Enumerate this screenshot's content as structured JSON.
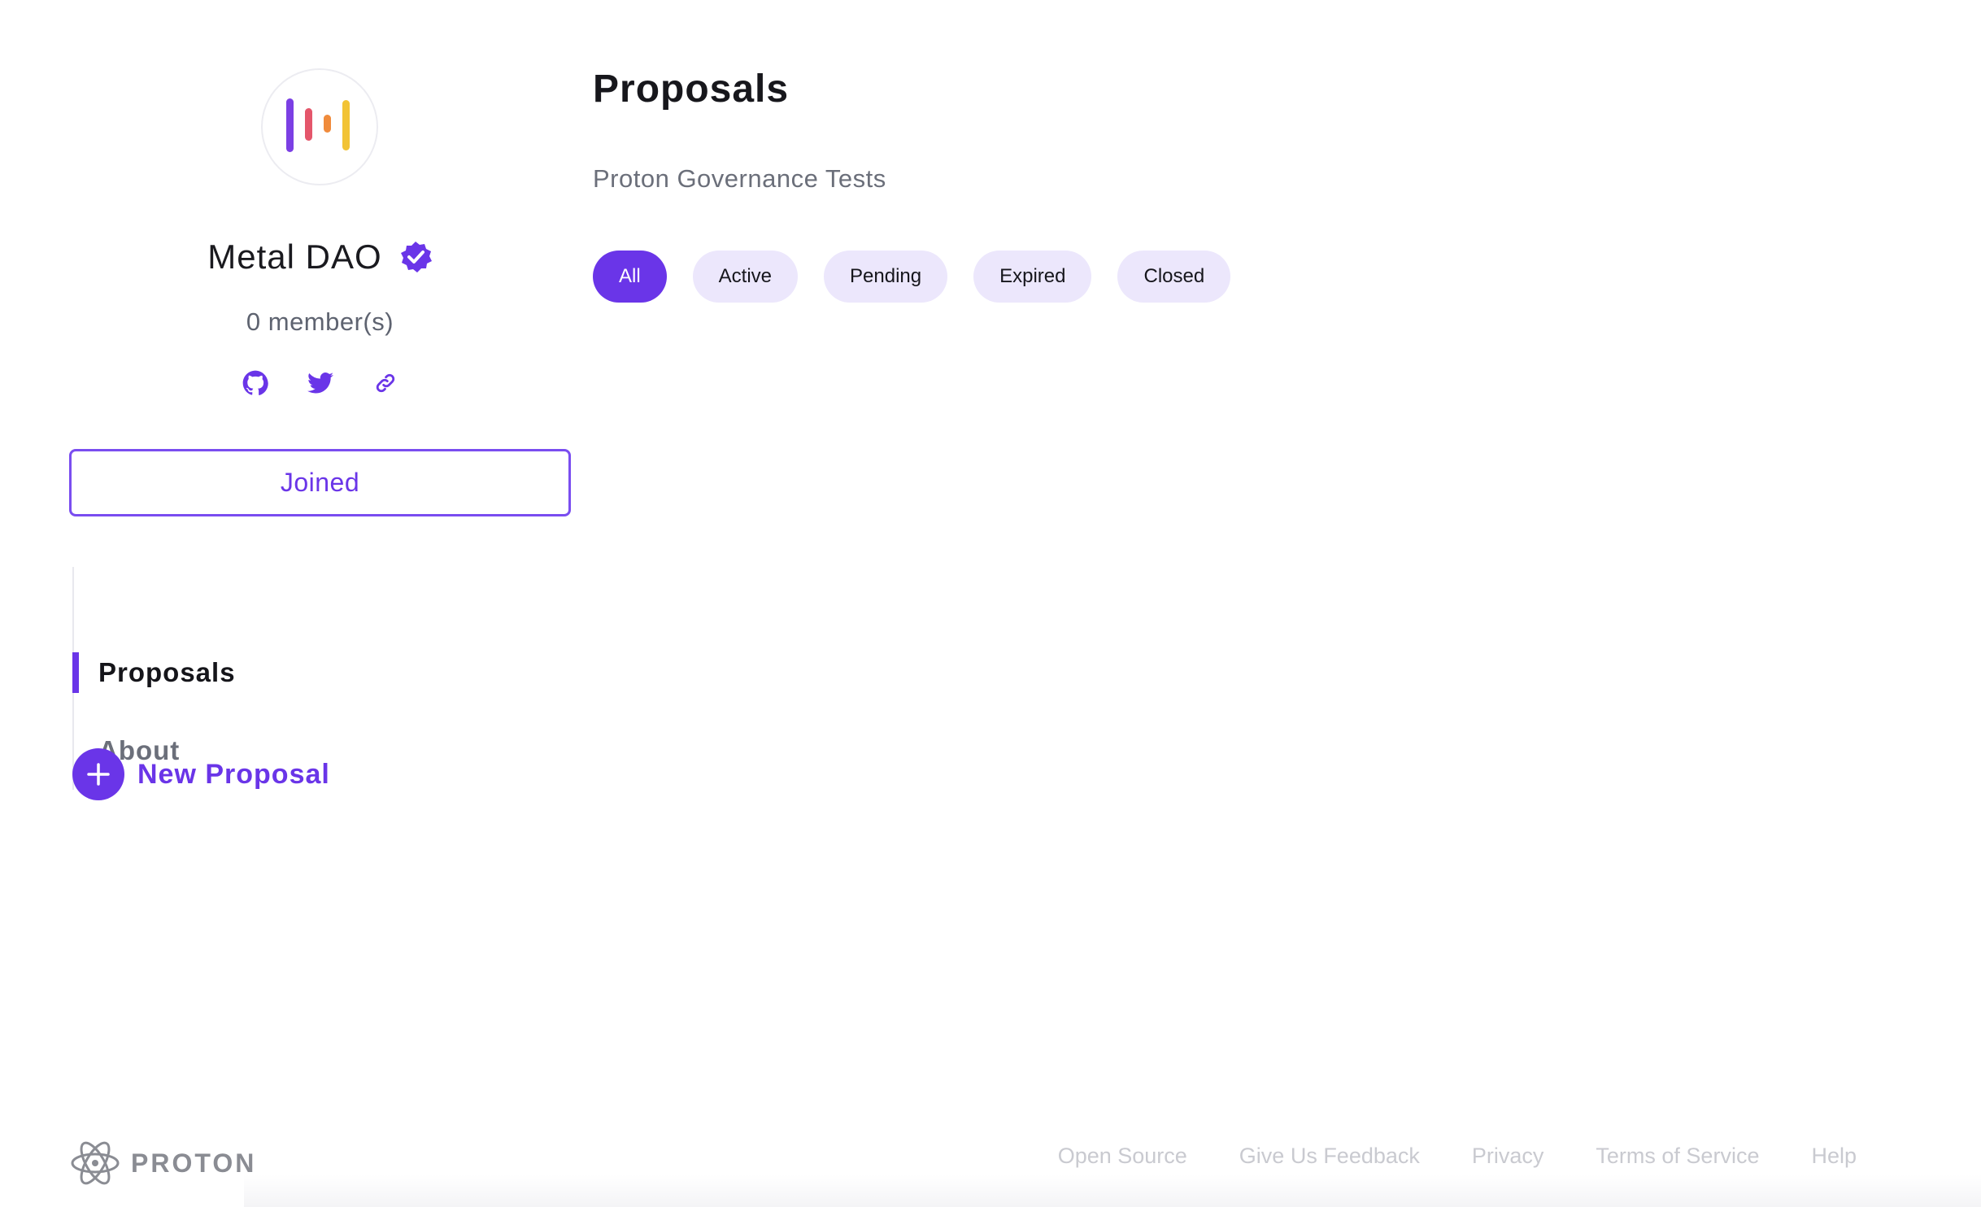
{
  "dao": {
    "name": "Metal DAO",
    "members": "0 member(s)",
    "join_label": "Joined",
    "logo_colors": [
      "#7b3fe4",
      "#e4566b",
      "#f08b3c",
      "#f2c335"
    ],
    "accent_color": "#6a35e8",
    "socials": [
      {
        "icon": "github-icon"
      },
      {
        "icon": "twitter-icon"
      },
      {
        "icon": "link-icon"
      }
    ]
  },
  "nav": {
    "items": [
      {
        "label": "Proposals",
        "active": true
      },
      {
        "label": "About",
        "active": false
      }
    ],
    "new_proposal_label": "New Proposal"
  },
  "main": {
    "title": "Proposals",
    "subtitle": "Proton Governance Tests",
    "filters": [
      {
        "label": "All",
        "selected": true
      },
      {
        "label": "Active",
        "selected": false
      },
      {
        "label": "Pending",
        "selected": false
      },
      {
        "label": "Expired",
        "selected": false
      },
      {
        "label": "Closed",
        "selected": false
      }
    ]
  },
  "footer": {
    "brand": "PROTON",
    "links": [
      "Open Source",
      "Give Us Feedback",
      "Privacy",
      "Terms of Service",
      "Help"
    ]
  }
}
